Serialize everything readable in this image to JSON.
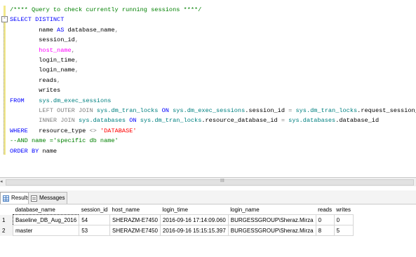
{
  "editor": {
    "collapse_symbol": "-",
    "lines": [
      {
        "parts": [
          {
            "t": "/**** Query to check currently running sessions ****/",
            "c": "cmt"
          }
        ]
      },
      {
        "parts": [
          {
            "t": "SELECT DISTINCT",
            "c": "kw"
          }
        ]
      },
      {
        "parts": [
          {
            "t": "        name ",
            "c": ""
          },
          {
            "t": "AS",
            "c": "kw"
          },
          {
            "t": " database_name",
            "c": ""
          },
          {
            "t": ",",
            "c": "op"
          }
        ]
      },
      {
        "parts": [
          {
            "t": "        session_id",
            "c": ""
          },
          {
            "t": ",",
            "c": "op"
          }
        ]
      },
      {
        "parts": [
          {
            "t": "        host_name",
            "c": "fn"
          },
          {
            "t": ",",
            "c": "op"
          }
        ]
      },
      {
        "parts": [
          {
            "t": "        login_time",
            "c": ""
          },
          {
            "t": ",",
            "c": "op"
          }
        ]
      },
      {
        "parts": [
          {
            "t": "        login_name",
            "c": ""
          },
          {
            "t": ",",
            "c": "op"
          }
        ]
      },
      {
        "parts": [
          {
            "t": "        reads",
            "c": ""
          },
          {
            "t": ",",
            "c": "op"
          }
        ]
      },
      {
        "parts": [
          {
            "t": "        writes",
            "c": ""
          }
        ]
      },
      {
        "parts": [
          {
            "t": "FROM",
            "c": "kw"
          },
          {
            "t": "    ",
            "c": ""
          },
          {
            "t": "sys.dm_exec_sessions",
            "c": "sys"
          }
        ]
      },
      {
        "parts": [
          {
            "t": "        LEFT OUTER JOIN ",
            "c": "gray"
          },
          {
            "t": "sys.dm_tran_locks",
            "c": "sys"
          },
          {
            "t": " ON ",
            "c": "kw"
          },
          {
            "t": "sys.dm_exec_sessions",
            "c": "sys"
          },
          {
            "t": ".session_id ",
            "c": ""
          },
          {
            "t": "=",
            "c": "op"
          },
          {
            "t": " ",
            "c": ""
          },
          {
            "t": "sys.dm_tran_locks",
            "c": "sys"
          },
          {
            "t": ".request_session_id",
            "c": ""
          }
        ]
      },
      {
        "parts": [
          {
            "t": "        INNER JOIN ",
            "c": "gray"
          },
          {
            "t": "sys.databases",
            "c": "sys"
          },
          {
            "t": " ON ",
            "c": "kw"
          },
          {
            "t": "sys.dm_tran_locks",
            "c": "sys"
          },
          {
            "t": ".resource_database_id ",
            "c": ""
          },
          {
            "t": "=",
            "c": "op"
          },
          {
            "t": " ",
            "c": ""
          },
          {
            "t": "sys.databases",
            "c": "sys"
          },
          {
            "t": ".database_id",
            "c": ""
          }
        ]
      },
      {
        "parts": [
          {
            "t": "WHERE",
            "c": "kw"
          },
          {
            "t": "   resource_type ",
            "c": ""
          },
          {
            "t": "<>",
            "c": "op"
          },
          {
            "t": " ",
            "c": ""
          },
          {
            "t": "'DATABASE'",
            "c": "str"
          }
        ]
      },
      {
        "parts": [
          {
            "t": "--AND name ='specific db name'",
            "c": "cmt"
          }
        ]
      },
      {
        "parts": [
          {
            "t": "ORDER BY",
            "c": "kw"
          },
          {
            "t": " name",
            "c": ""
          }
        ]
      }
    ]
  },
  "scrollbar": {
    "grip": "III",
    "left_arrow": "◂"
  },
  "tabs": [
    {
      "label": "Results",
      "icon": "results-grid-icon"
    },
    {
      "label": "Messages",
      "icon": "messages-icon"
    }
  ],
  "results": {
    "columns": [
      "database_name",
      "session_id",
      "host_name",
      "login_time",
      "login_name",
      "reads",
      "writes"
    ],
    "rows": [
      {
        "num": "1",
        "cells": [
          "Baseline_DB_Aug_2016",
          "54",
          "SHERAZM-E7450",
          "2016-09-16 17:14:09.060",
          "BURGESSGROUP\\Sheraz.Mirza",
          "0",
          "0"
        ]
      },
      {
        "num": "2",
        "cells": [
          "master",
          "53",
          "SHERAZM-E7450",
          "2016-09-16 15:15:15.397",
          "BURGESSGROUP\\Sheraz.Mirza",
          "8",
          "5"
        ]
      }
    ]
  }
}
